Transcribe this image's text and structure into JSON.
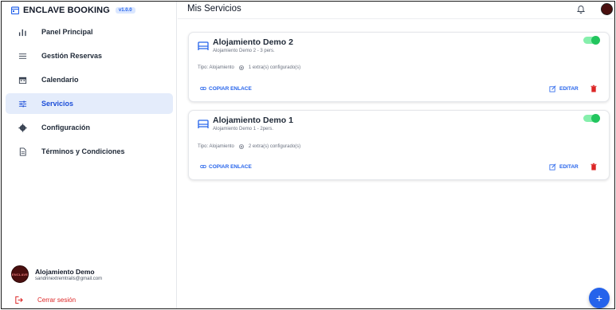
{
  "app": {
    "title": "ENCLAVE BOOKING",
    "version": "v1.0.0"
  },
  "sidebar": {
    "items": [
      {
        "label": "Panel Principal",
        "icon": "bar-chart-icon",
        "active": false
      },
      {
        "label": "Gestión Reservas",
        "icon": "list-icon",
        "active": false
      },
      {
        "label": "Calendario",
        "icon": "calendar-icon",
        "active": false
      },
      {
        "label": "Servicios",
        "icon": "sliders-icon",
        "active": true
      },
      {
        "label": "Configuración",
        "icon": "gear-icon",
        "active": false
      },
      {
        "label": "Términos y Condiciones",
        "icon": "document-icon",
        "active": false
      }
    ],
    "user": {
      "name": "Alojamiento Demo",
      "email": "sandrinextremtrails@gmail.com",
      "avatar_text": "ENCLAVE"
    },
    "logout_label": "Cerrar sesión"
  },
  "header": {
    "title": "Mis Servicios"
  },
  "services": [
    {
      "title": "Alojamiento Demo 2",
      "subtitle": "Alojamiento Demo 2 - 3 pers.",
      "type": "Tipo: Alojamiento",
      "extras": "1 extra(s) configurado(s)",
      "copy_label": "COPIAR ENLACE",
      "edit_label": "EDITAR",
      "enabled": true
    },
    {
      "title": "Alojamiento Demo 1",
      "subtitle": "Alojamiento Demo 1 - 2pers.",
      "type": "Tipo: Alojamiento",
      "extras": "2 extra(s) configurado(s)",
      "copy_label": "COPIAR ENLACE",
      "edit_label": "EDITAR",
      "enabled": true
    }
  ],
  "fab": {
    "label": "+"
  },
  "colors": {
    "accent": "#2563eb",
    "active_bg": "#e4ecfb",
    "danger": "#dc2626",
    "toggle_on": "#22c55e"
  }
}
